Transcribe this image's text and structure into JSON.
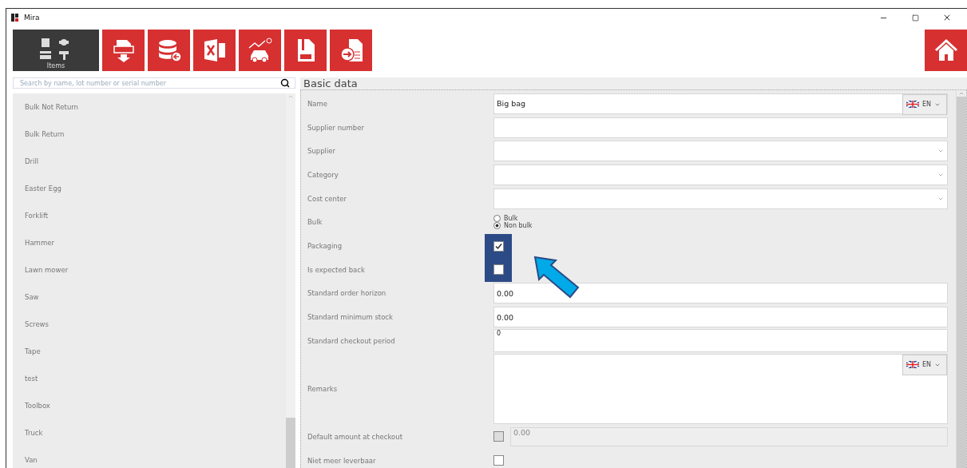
{
  "window": {
    "title": "Mira"
  },
  "toolbar": {
    "items_tile": {
      "label": "Items",
      "selected": true
    }
  },
  "search": {
    "placeholder": "Search by name, lot number or serial number"
  },
  "sidebar": {
    "items": [
      "Bulk Not Return",
      "Bulk Return",
      "Drill",
      "Easter Egg",
      "Forklift",
      "Hammer",
      "Lawn mower",
      "Saw",
      "Screws",
      "Tape",
      "test",
      "Toolbox",
      "Truck",
      "Van"
    ]
  },
  "section": {
    "title": "Basic data"
  },
  "fields": [
    {
      "kind": "text",
      "label": "Name",
      "value": "Big bag",
      "language": "EN"
    },
    {
      "kind": "text",
      "label": "Supplier number"
    },
    {
      "kind": "dropdown",
      "label": "Supplier"
    },
    {
      "kind": "dropdown",
      "label": "Category"
    },
    {
      "kind": "dropdown",
      "label": "Cost center"
    },
    {
      "kind": "radio",
      "label": "Bulk",
      "options": [
        {
          "label": "Bulk",
          "selected": false
        },
        {
          "label": "Non bulk",
          "selected": true
        }
      ]
    },
    {
      "kind": "checkbox",
      "label": "Packaging",
      "checked": true,
      "highlighted": true
    },
    {
      "kind": "checkbox",
      "label": "Is expected back",
      "checked": false,
      "highlighted": true
    },
    {
      "kind": "number",
      "label": "Standard order horizon",
      "value": "0.00"
    },
    {
      "kind": "number",
      "label": "Standard minimum stock",
      "value": "0.00"
    },
    {
      "kind": "period",
      "label": "Standard checkout period",
      "value": "0"
    },
    {
      "kind": "textarea",
      "label": "Remarks",
      "language": "EN"
    },
    {
      "kind": "checkbox_number",
      "label": "Default amount at checkout",
      "value": "0.00",
      "disabled": true
    },
    {
      "kind": "checkbox",
      "label": "Niet meer leverbaar",
      "checked": false,
      "highlighted": false
    }
  ]
}
